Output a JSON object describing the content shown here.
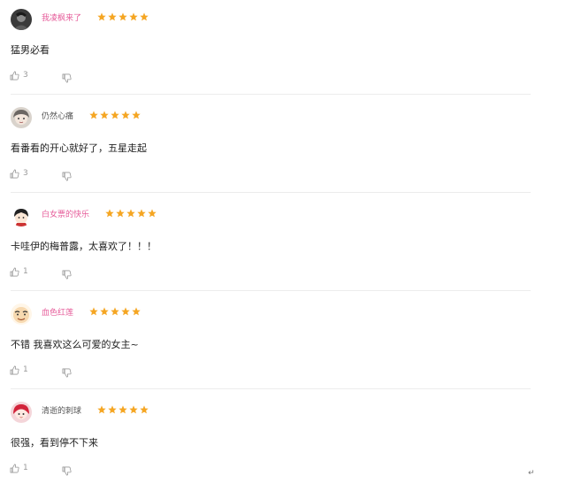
{
  "colors": {
    "username_highlight": "#e65c9a",
    "username_normal": "#555555",
    "star": "#f5a623",
    "muted": "#999999"
  },
  "reviews": [
    {
      "username": "我凌枫来了",
      "username_color": "#e65c9a",
      "rating": 5,
      "content": "猛男必看",
      "likes": "3",
      "avatar": "dark-portrait-avatar"
    },
    {
      "username": "仍然心痛",
      "username_color": "#555555",
      "rating": 5,
      "content": "看番看的开心就好了，五星走起",
      "likes": "3",
      "avatar": "anime-girl-avatar"
    },
    {
      "username": "白女票的快乐",
      "username_color": "#e65c9a",
      "rating": 5,
      "content": "卡哇伊的梅普露，太喜欢了！！！",
      "likes": "1",
      "avatar": "chibi-avatar"
    },
    {
      "username": "血色红莲",
      "username_color": "#e65c9a",
      "rating": 5,
      "content": "不错 我喜欢这么可爱的女主~",
      "likes": "1",
      "avatar": "cartoon-face-avatar"
    },
    {
      "username": "清逝的刺球",
      "username_color": "#555555",
      "rating": 5,
      "content": "很强，看到停不下来",
      "likes": "1",
      "avatar": "red-hair-avatar"
    }
  ],
  "icons": {
    "like": "thumbs-up-icon",
    "dislike": "thumbs-down-icon",
    "star": "star-icon"
  },
  "return_mark": "↵"
}
